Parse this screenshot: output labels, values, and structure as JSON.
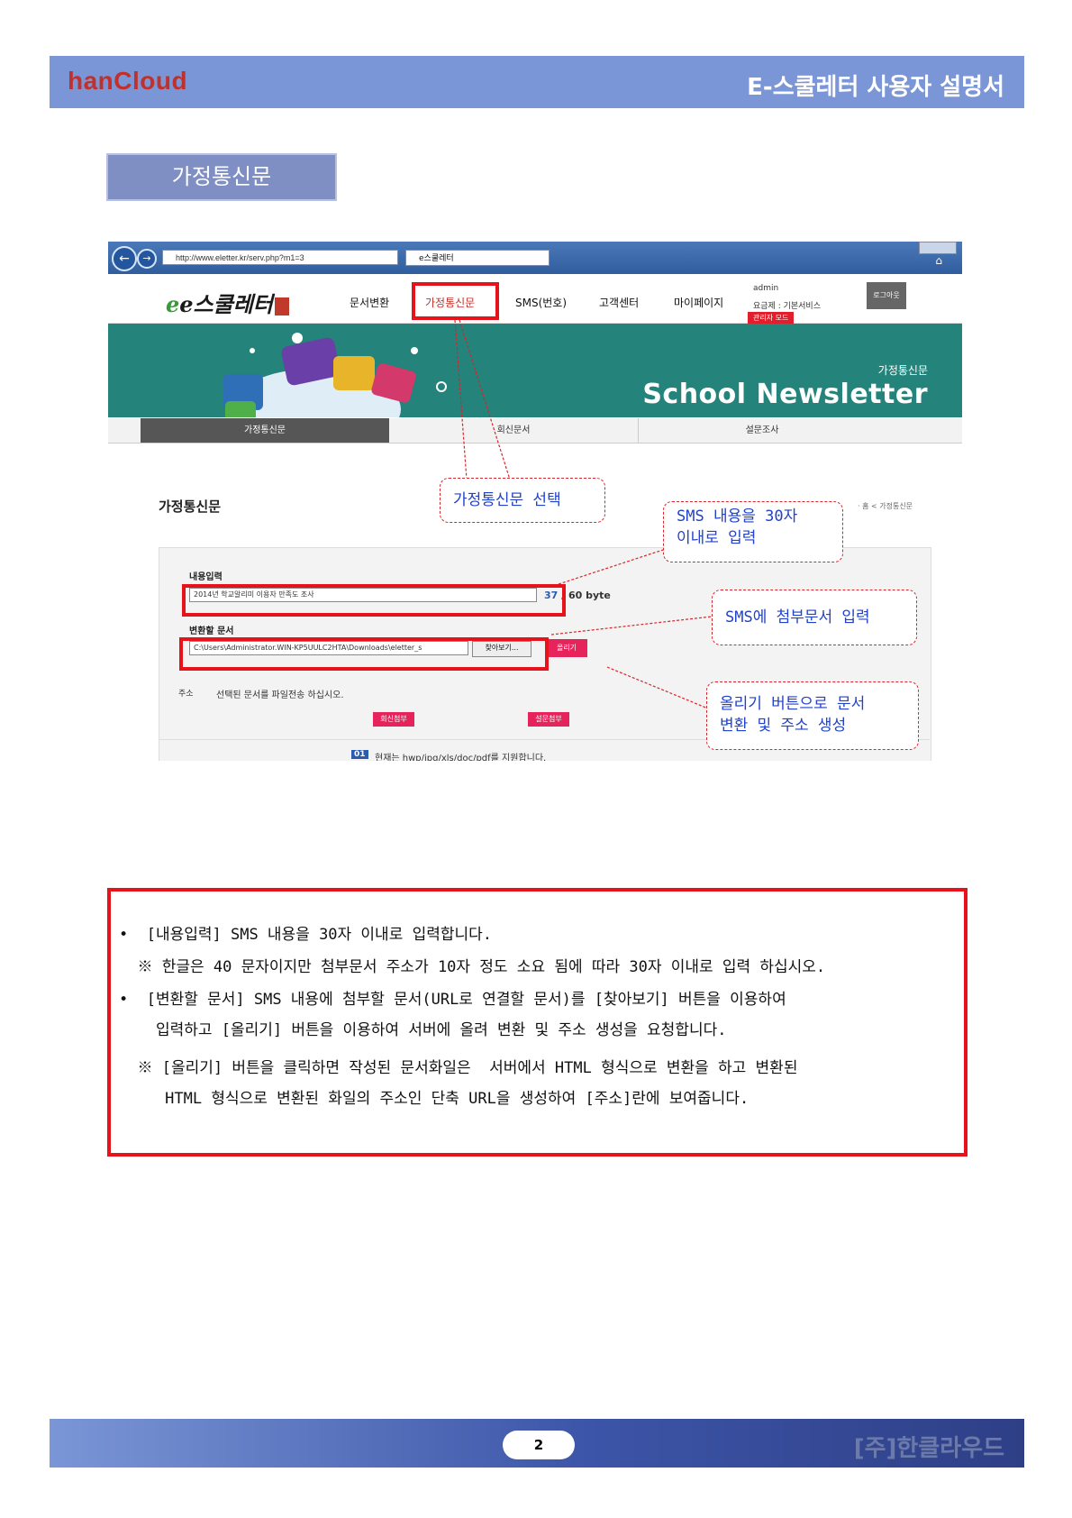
{
  "header": {
    "logo": "hanCloud",
    "title": "E-스쿨레터 사용자 설명서"
  },
  "section_title": "가정통신문",
  "screenshot": {
    "browser": {
      "url": "http://www.eletter.kr/serv.php?m1=3",
      "tab_title": "e스쿨레터"
    },
    "site_logo": "e스쿨레터",
    "menu": [
      "문서변환",
      "가정통신문",
      "SMS(번호)",
      "고객센터",
      "마이페이지"
    ],
    "admin": "admin",
    "plan": "요금제 : 기본서비스",
    "admin_mode": "관리자 모드",
    "logout": "로그아웃",
    "banner": {
      "sub": "가정통신문",
      "title": "School Newsletter"
    },
    "subtabs": [
      "가정통신문",
      "회신문서",
      "설문조사"
    ],
    "page_heading": "가정통신문",
    "breadcrumb": "· 홈 < 가정통신문",
    "form": {
      "content_label": "내용입력",
      "content_value": "2014년 학교알리미 이용자 만족도 조사",
      "byte_count": "37",
      "byte_suffix": " / 60 byte",
      "file_label": "변환할 문서",
      "file_value": "C:\\Users\\Administrator.WIN-KP5UULC2HTA\\Downloads\\eletter_s",
      "browse": "찾아보기...",
      "upload": "올리기",
      "address_label": "주소",
      "address_text": "선택된 문서를 파일전송 하십시오.",
      "reply_attach": "회신첨부",
      "survey_attach": "설문첨부",
      "notice_num": "01",
      "notice_text": "현재는 hwp/jpg/xls/doc/pdf를 지원합니다."
    }
  },
  "callouts": {
    "select": "가정통신문 선택",
    "sms_line1": "SMS 내용을 30자",
    "sms_line2": "이내로 입력",
    "attach": "SMS에 첨부문서 입력",
    "upload_line1": "올리기 버튼으로 문서",
    "upload_line2": "변환 및 주소 생성"
  },
  "notes": [
    "•  [내용입력] SMS 내용을 30자 이내로 입력합니다.",
    "  ※ 한글은 40 문자이지만 첨부문서 주소가 10자 정도 소요 됨에 따라 30자 이내로 입력 하십시오.",
    "•  [변환할 문서] SMS 내용에 첨부할 문서(URL로 연결할 문서)를 [찾아보기] 버튼을 이용하여",
    "    입력하고 [올리기] 버튼을 이용하여 서버에 올려 변환 및 주소 생성을 요청합니다.",
    "  ※ [올리기] 버튼을 클릭하면 작성된 문서화일은  서버에서 HTML 형식으로 변환을 하고 변환된",
    "     HTML 형식으로 변환된 화일의 주소인 단축 URL을 생성하여 [주소]란에 보여줍니다."
  ],
  "footer": {
    "page": "2",
    "company": "[주]한클라우드"
  },
  "colors": {
    "header_blue": "#7b96d6",
    "highlight_red": "#e8121b",
    "callout_text": "#2242c8",
    "banner_teal": "#24837a"
  }
}
